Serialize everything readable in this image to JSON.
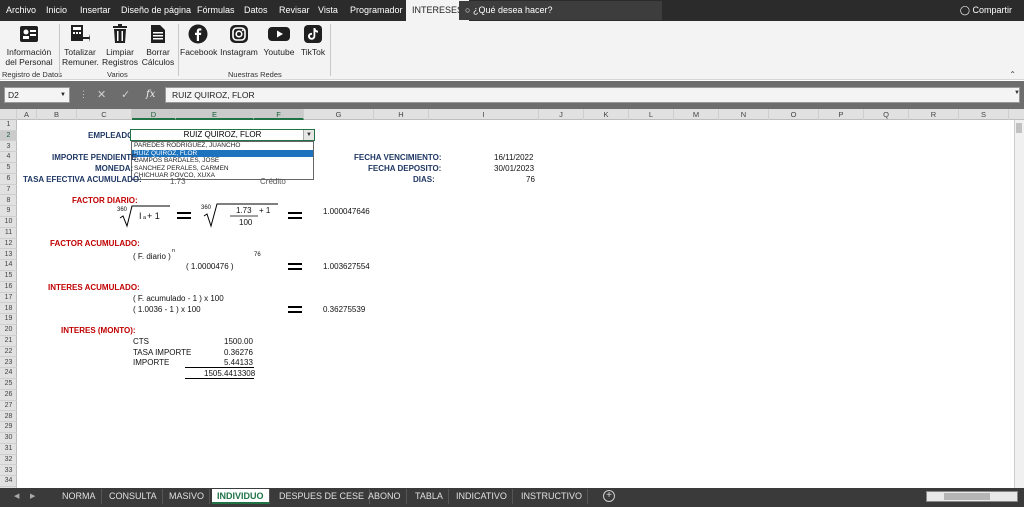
{
  "ribbon_tabs": [
    "Archivo",
    "Inicio",
    "Insertar",
    "Diseño de página",
    "Fórmulas",
    "Datos",
    "Revisar",
    "Vista",
    "Programador",
    "INTERESES"
  ],
  "active_tab": "INTERESES",
  "tell_me_placeholder": "¿Qué desea hacer?",
  "share_label": "Compartir",
  "ribbon": {
    "groups": [
      {
        "label": "Registro de Datos",
        "buttons": [
          {
            "label": "Información\ndel Personal",
            "icon": "person-card-icon"
          }
        ]
      },
      {
        "label": "Varios",
        "buttons": [
          {
            "label": "Totalizar\nRemuner.",
            "icon": "calculator-icon"
          },
          {
            "label": "Limpiar\nRegistros",
            "icon": "trash-icon"
          },
          {
            "label": "Borrar\nCálculos",
            "icon": "document-icon"
          }
        ]
      },
      {
        "label": "Nuestras Redes",
        "buttons": [
          {
            "label": "Facebook",
            "icon": "facebook-icon"
          },
          {
            "label": "Instagram",
            "icon": "instagram-icon"
          },
          {
            "label": "Youtube",
            "icon": "youtube-icon"
          },
          {
            "label": "TikTok",
            "icon": "tiktok-icon"
          }
        ]
      }
    ]
  },
  "name_box": "D2",
  "formula_bar": "RUIZ QUIROZ, FLOR",
  "columns": [
    "A",
    "B",
    "C",
    "D",
    "E",
    "F",
    "G",
    "H",
    "I",
    "J",
    "K",
    "L",
    "M",
    "N",
    "O",
    "P",
    "Q",
    "R",
    "S"
  ],
  "selected_columns": [
    "D",
    "E",
    "F"
  ],
  "selected_row": 2,
  "rows": [
    "1",
    "2",
    "3",
    "4",
    "5",
    "6",
    "7",
    "8",
    "9",
    "10",
    "11",
    "12",
    "13",
    "14",
    "15",
    "16",
    "17",
    "18",
    "19",
    "20",
    "21",
    "22",
    "23",
    "24",
    "25",
    "26",
    "27",
    "28",
    "29",
    "30",
    "31",
    "32",
    "33",
    "34"
  ],
  "sheet": {
    "empleado_label": "EMPLEADO:",
    "empleado_value": "RUIZ QUIROZ, FLOR",
    "dropdown_options": [
      "PAREDES RODRIGUEZ, JUANCHO",
      "RUIZ QUIROZ, FLOR",
      "CAMPOS BARDALES, JOSE",
      "SANCHEZ PERALES, CARMEN",
      "CHICHUAR POVCO, XUXA"
    ],
    "dropdown_selected_index": 1,
    "importe_pendiente_label": "IMPORTE PENDIENTE:",
    "moneda_label": "MONEDA:",
    "tasa_label": "TASA EFECTIVA ACUMULADO:",
    "tasa_value": "1.73",
    "tasa_type": "Crédito",
    "fecha_venc_label": "FECHA VENCIMIENTO:",
    "fecha_venc_value": "16/11/2022",
    "fecha_dep_label": "FECHA DEPOSITO:",
    "fecha_dep_value": "30/01/2023",
    "dias_label": "DIAS:",
    "dias_value": "76",
    "factor_diario_label": "FACTOR DIARIO:",
    "fd_root1": "360",
    "fd_inner1": "I",
    "fd_sub": "a",
    "fd_plus1": "+ 1",
    "fd_root2": "360",
    "fd_num": "1.73",
    "fd_plus2": "+ 1",
    "fd_den": "100",
    "fd_result": "1.000047646",
    "factor_acumulado_label": "FACTOR ACUMULADO:",
    "fa_formula": "( F. diario )",
    "fa_exp": "n",
    "fa_dias": "76",
    "fa_value": "( 1.0000476 )",
    "fa_result": "1.003627554",
    "interes_acumulado_label": "INTERES ACUMULADO:",
    "ia_formula": "( F. acumulado - 1 )  x 100",
    "ia_value": "( 1.0036 - 1 ) x 100",
    "ia_result": "0.36275539",
    "interes_monto_label": "INTERES (MONTO):",
    "im_rows": [
      {
        "label": "CTS",
        "value": "1500.00"
      },
      {
        "label": "TASA IMPORTE",
        "value": "0.36276"
      },
      {
        "label": "IMPORTE",
        "value": "5.44133"
      }
    ],
    "im_total": "1505.4413308"
  },
  "sheet_tabs": [
    "NORMA",
    "CONSULTA",
    "MASIVO",
    "INDIVIDUO",
    "DESPUES DE CESE",
    "ABONO",
    "TABLA",
    "INDICATIVO",
    "INSTRUCTIVO"
  ],
  "active_sheet": "INDIVIDUO"
}
